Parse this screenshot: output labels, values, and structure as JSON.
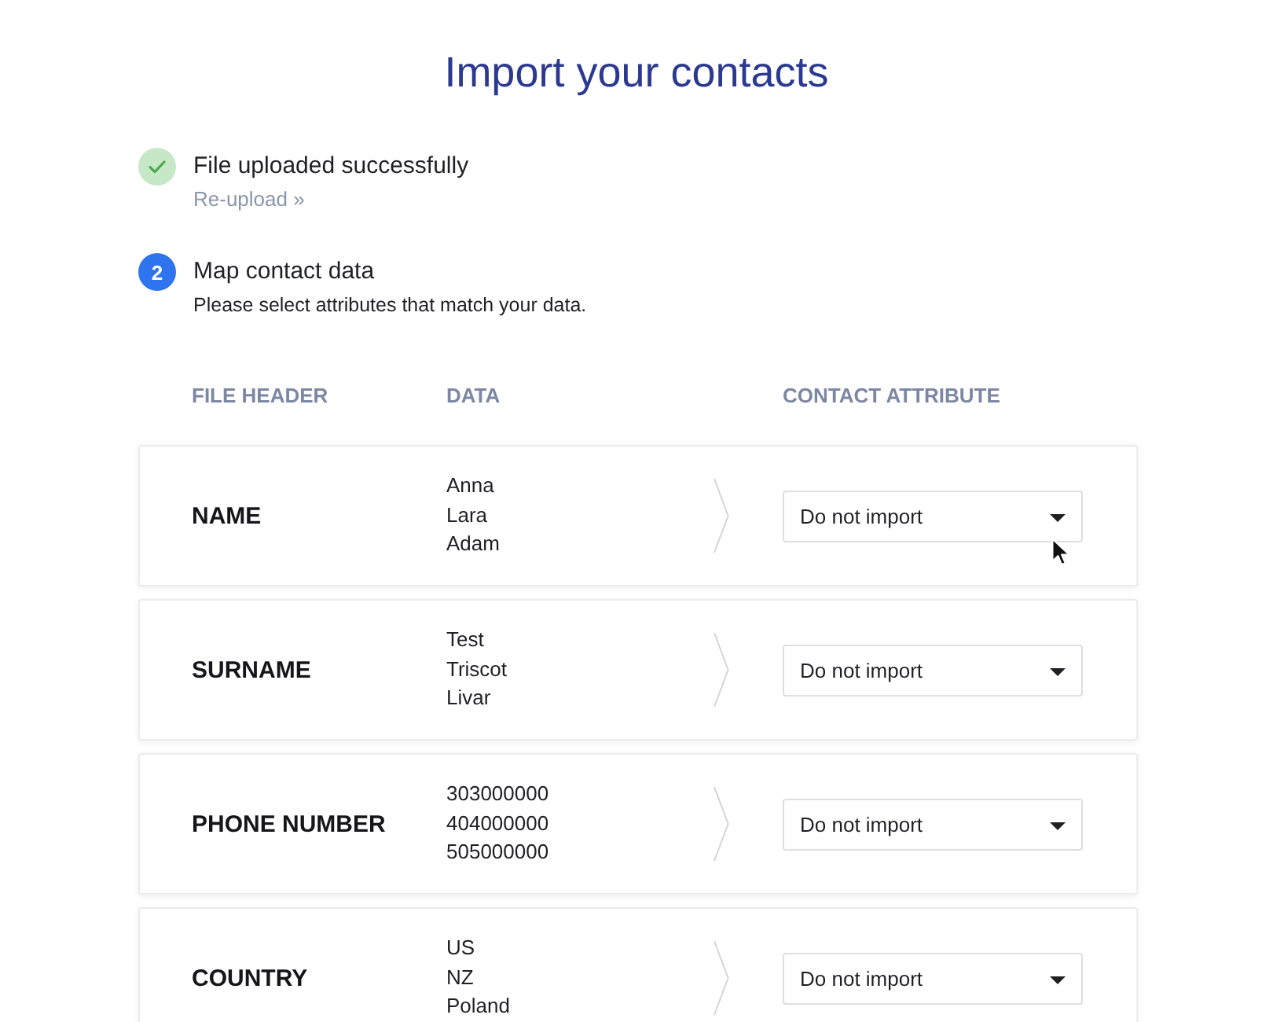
{
  "title": "Import your contacts",
  "steps": [
    {
      "kind": "done",
      "title": "File uploaded successfully",
      "link": "Re-upload »"
    },
    {
      "kind": "number",
      "number": "2",
      "title": "Map contact data",
      "description": "Please select attributes that match your data."
    }
  ],
  "table": {
    "columns": [
      "FILE HEADER",
      "DATA",
      "CONTACT ATTRIBUTE"
    ],
    "rows": [
      {
        "header": "NAME",
        "data": [
          "Anna",
          "Lara",
          "Adam"
        ],
        "attribute": "Do not import"
      },
      {
        "header": "SURNAME",
        "data": [
          "Test",
          "Triscot",
          "Livar"
        ],
        "attribute": "Do not import"
      },
      {
        "header": "PHONE NUMBER",
        "data": [
          "303000000",
          "404000000",
          "505000000"
        ],
        "attribute": "Do not import"
      },
      {
        "header": "COUNTRY",
        "data": [
          "US",
          "NZ",
          "Poland"
        ],
        "attribute": "Do not import"
      }
    ]
  }
}
